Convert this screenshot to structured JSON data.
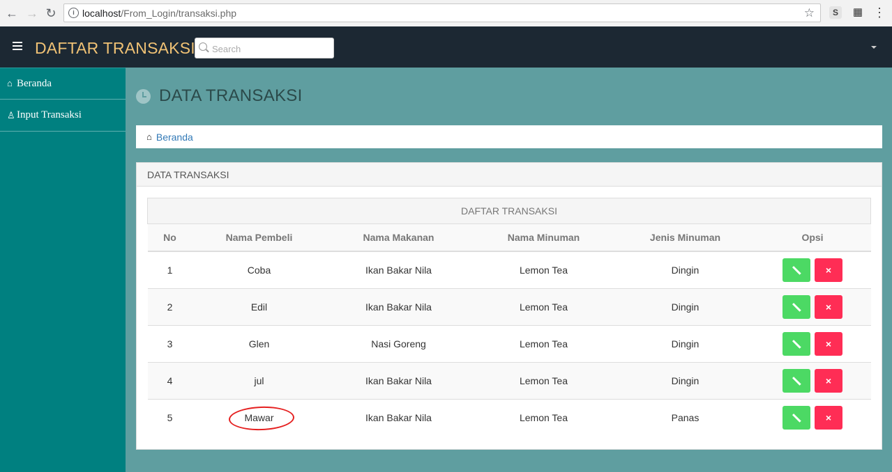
{
  "browser": {
    "url_host": "localhost",
    "url_path": "/From_Login/transaksi.php",
    "ext1_label": "S"
  },
  "header": {
    "brand": "DAFTAR TRANSAKSI",
    "search_placeholder": "Search"
  },
  "sidebar": {
    "items": [
      {
        "label": "Beranda",
        "icon": "home-icon"
      },
      {
        "label": "Input Transaksi",
        "icon": "user-icon"
      }
    ]
  },
  "main": {
    "title": "DATA TRANSAKSI",
    "breadcrumb": "Beranda",
    "panel_title": "DATA TRANSAKSI",
    "table_caption": "DAFTAR TRANSAKSI",
    "columns": [
      "No",
      "Nama Pembeli",
      "Nama Makanan",
      "Nama Minuman",
      "Jenis Minuman",
      "Opsi"
    ],
    "rows": [
      {
        "no": "1",
        "pembeli": "Coba",
        "makanan": "Ikan Bakar Nila",
        "minuman": "Lemon Tea",
        "jenis": "Dingin"
      },
      {
        "no": "2",
        "pembeli": "Edil",
        "makanan": "Ikan Bakar Nila",
        "minuman": "Lemon Tea",
        "jenis": "Dingin"
      },
      {
        "no": "3",
        "pembeli": "Glen",
        "makanan": "Nasi Goreng",
        "minuman": "Lemon Tea",
        "jenis": "Dingin"
      },
      {
        "no": "4",
        "pembeli": "jul",
        "makanan": "Ikan Bakar Nila",
        "minuman": "Lemon Tea",
        "jenis": "Dingin"
      },
      {
        "no": "5",
        "pembeli": "Mawar",
        "makanan": "Ikan Bakar Nila",
        "minuman": "Lemon Tea",
        "jenis": "Panas"
      }
    ]
  },
  "colors": {
    "header_bg": "#1c2833",
    "brand": "#f0c275",
    "sidebar_bg": "#008080",
    "content_bg": "#5f9ea0",
    "edit_btn": "#4cd964",
    "delete_btn": "#ff2d55"
  }
}
